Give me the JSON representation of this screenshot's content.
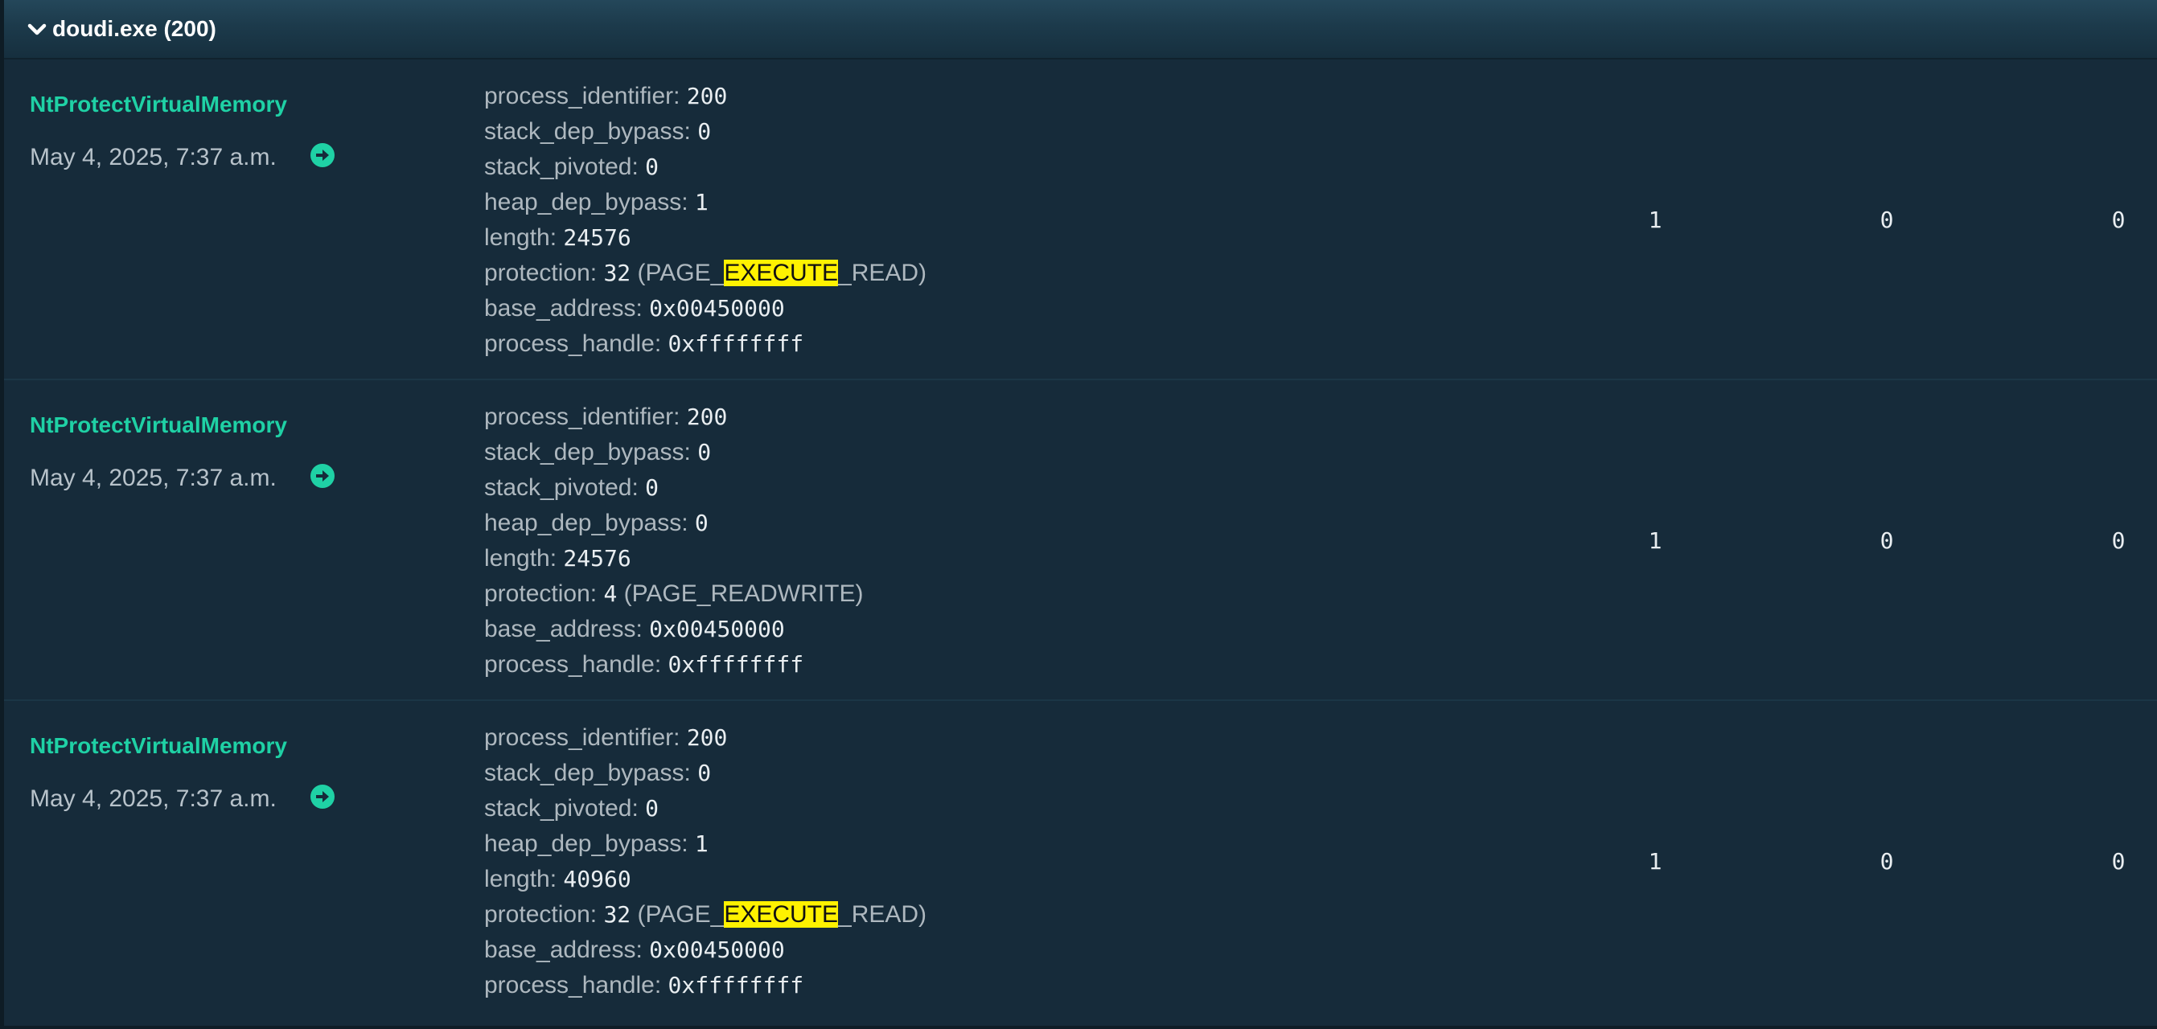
{
  "section": {
    "title": "doudi.exe (200)"
  },
  "calls": [
    {
      "api": "NtProtectVirtualMemory",
      "timestamp": "May 4, 2025, 7:37 a.m.",
      "args": {
        "process_identifier": {
          "key": "process_identifier:",
          "value": "200"
        },
        "stack_dep_bypass": {
          "key": "stack_dep_bypass:",
          "value": "0"
        },
        "stack_pivoted": {
          "key": "stack_pivoted:",
          "value": "0"
        },
        "heap_dep_bypass": {
          "key": "heap_dep_bypass:",
          "value": "1"
        },
        "length": {
          "key": "length:",
          "value": "24576"
        },
        "protection": {
          "key": "protection:",
          "value": "32",
          "pretty_pre": "(PAGE_",
          "pretty_hl": "EXECUTE",
          "pretty_post": "_READ)"
        },
        "base_address": {
          "key": "base_address:",
          "value": "0x00450000"
        },
        "process_handle": {
          "key": "process_handle:",
          "value": "0xffffffff"
        }
      },
      "status": "1",
      "return": "0",
      "repeated": "0"
    },
    {
      "api": "NtProtectVirtualMemory",
      "timestamp": "May 4, 2025, 7:37 a.m.",
      "args": {
        "process_identifier": {
          "key": "process_identifier:",
          "value": "200"
        },
        "stack_dep_bypass": {
          "key": "stack_dep_bypass:",
          "value": "0"
        },
        "stack_pivoted": {
          "key": "stack_pivoted:",
          "value": "0"
        },
        "heap_dep_bypass": {
          "key": "heap_dep_bypass:",
          "value": "0"
        },
        "length": {
          "key": "length:",
          "value": "24576"
        },
        "protection": {
          "key": "protection:",
          "value": "4",
          "pretty_pre": "(PAGE_READWRITE)",
          "pretty_hl": "",
          "pretty_post": ""
        },
        "base_address": {
          "key": "base_address:",
          "value": "0x00450000"
        },
        "process_handle": {
          "key": "process_handle:",
          "value": "0xffffffff"
        }
      },
      "status": "1",
      "return": "0",
      "repeated": "0"
    },
    {
      "api": "NtProtectVirtualMemory",
      "timestamp": "May 4, 2025, 7:37 a.m.",
      "args": {
        "process_identifier": {
          "key": "process_identifier:",
          "value": "200"
        },
        "stack_dep_bypass": {
          "key": "stack_dep_bypass:",
          "value": "0"
        },
        "stack_pivoted": {
          "key": "stack_pivoted:",
          "value": "0"
        },
        "heap_dep_bypass": {
          "key": "heap_dep_bypass:",
          "value": "1"
        },
        "length": {
          "key": "length:",
          "value": "40960"
        },
        "protection": {
          "key": "protection:",
          "value": "32",
          "pretty_pre": "(PAGE_",
          "pretty_hl": "EXECUTE",
          "pretty_post": "_READ)"
        },
        "base_address": {
          "key": "base_address:",
          "value": "0x00450000"
        },
        "process_handle": {
          "key": "process_handle:",
          "value": "0xffffffff"
        }
      },
      "status": "1",
      "return": "0",
      "repeated": "0"
    }
  ],
  "icons": {
    "collapse": "chevron-down-icon",
    "goto": "arrow-circle-right-icon"
  },
  "colors": {
    "accent": "#1fd1a5",
    "highlight": "#fff200",
    "panel_bg": "#162b3a",
    "header_bg": "#1c3a4b"
  }
}
